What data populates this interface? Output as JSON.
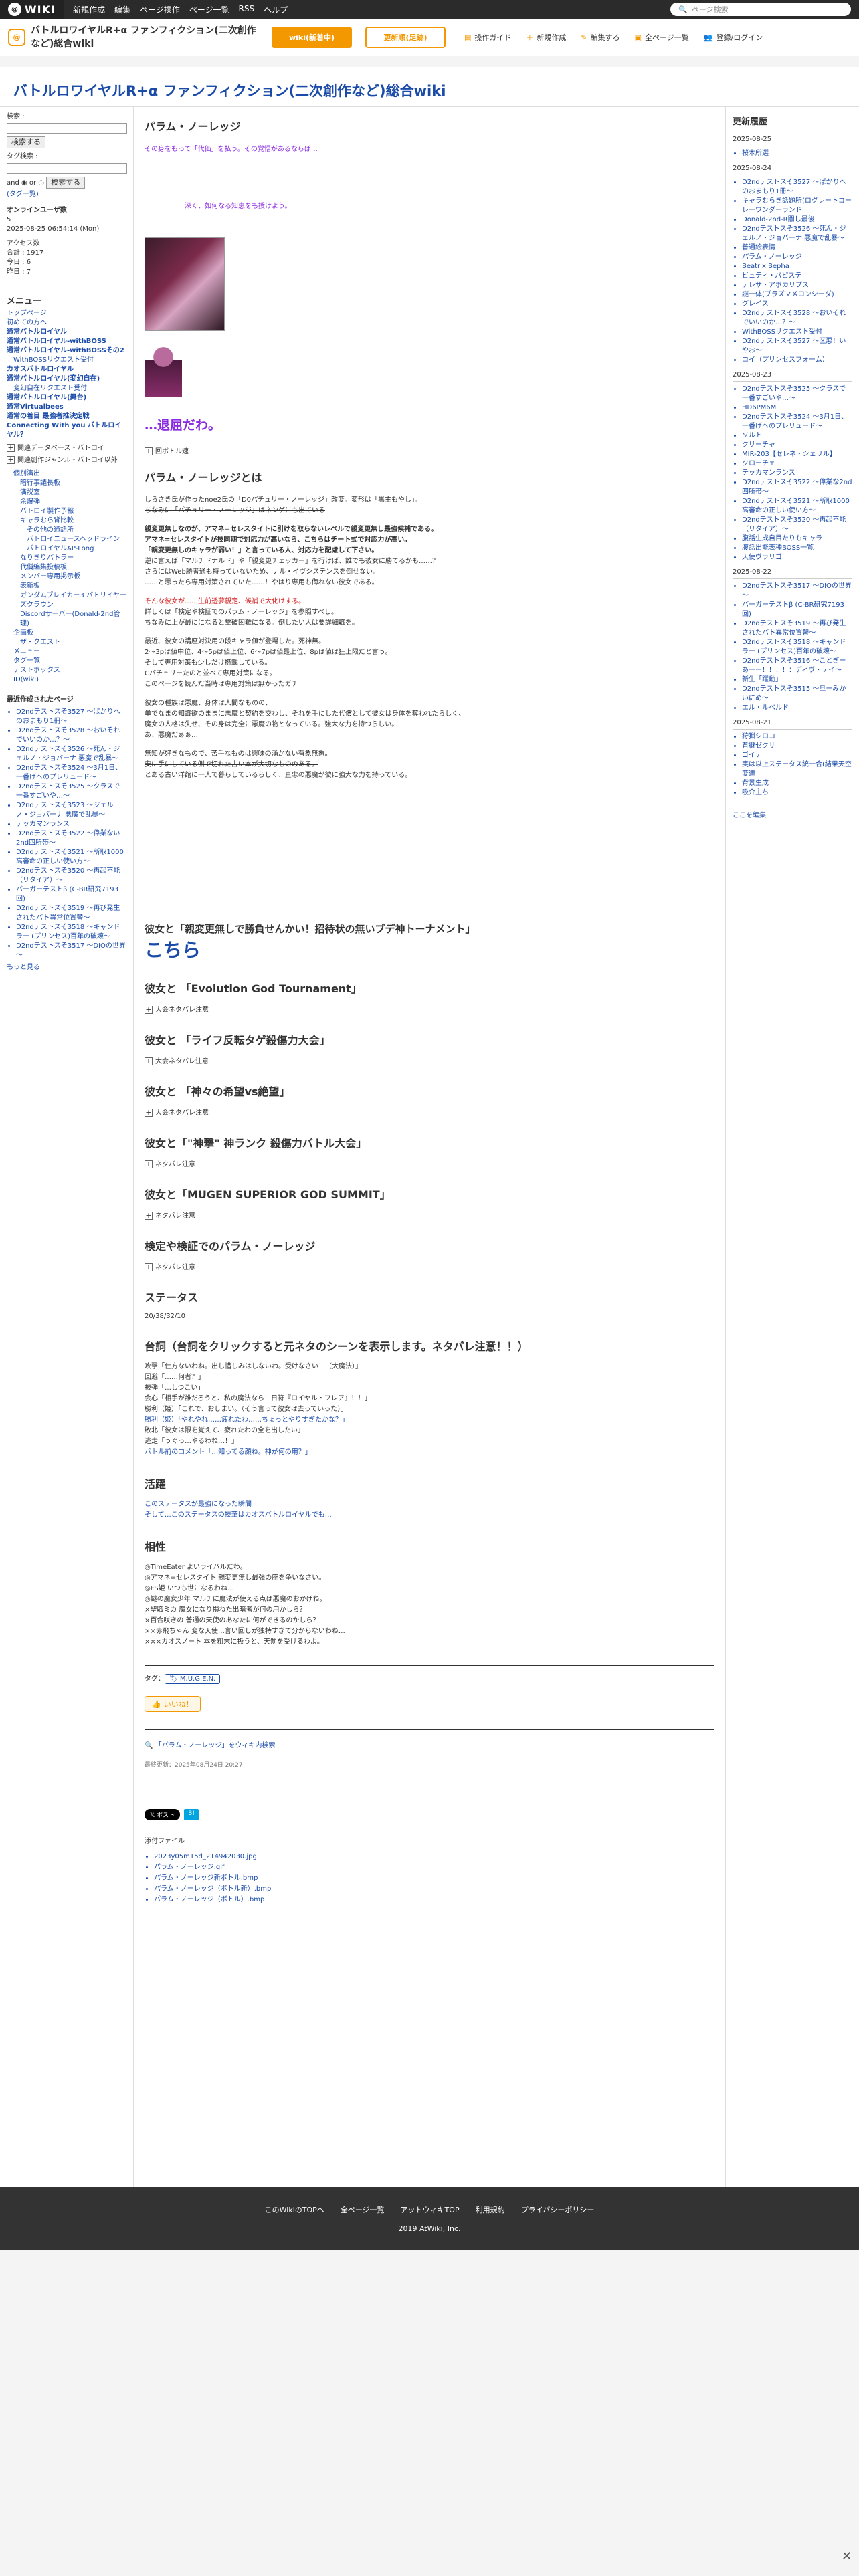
{
  "topbar": {
    "logo": "WIKI",
    "menu": [
      "新規作成",
      "編集",
      "ページ操作",
      "ページ一覧",
      "RSS",
      "ヘルプ"
    ],
    "search_placeholder": "ページ検索"
  },
  "header": {
    "title": "バトルロワイヤルR+α ファンフィクション(二次創作など)総合wiki",
    "btn_home": "wiki(新着中)",
    "btn_log": "更新順(足跡)",
    "nav": [
      "操作ガイド",
      "新規作成",
      "編集する",
      "全ページ一覧",
      "登録/ログイン"
    ]
  },
  "page_title": "バトルロワイヤルR+α ファンフィクション(二次創作など)総合wiki",
  "left": {
    "search_label": "検索 :",
    "search_btn": "検索する",
    "tag_label": "タグ検索 :",
    "and_or": "and ◉ or ○",
    "tag_btn": "検索する",
    "tag_link": "(タグ一覧)",
    "online_label": "オンラインユーザ数",
    "online_count": "5",
    "datetime": "2025-08-25 06:54:14 (Mon)",
    "access": "アクセス数",
    "total": "合計 : 1917",
    "today": "今日 : 6",
    "yesterday": "昨日 : 7",
    "menu_title": "メニュー",
    "menu": [
      {
        "t": "トップページ",
        "l": 0
      },
      {
        "t": "初めての方へ",
        "l": 0
      },
      {
        "t": "通常バトルロイヤル",
        "l": 0
      },
      {
        "t": "通常バトルロイヤル-withBOSS",
        "l": 0
      },
      {
        "t": "通常バトルロイヤル-withBOSSその2",
        "l": 0
      },
      {
        "t": "WithBOSSリクエスト受付",
        "l": 1
      },
      {
        "t": "カオスバトルロイヤル",
        "l": 0
      },
      {
        "t": "通常バトルロイヤル(変幻自在)",
        "l": 0
      },
      {
        "t": "変幻自在リクエスト受付",
        "l": 1
      },
      {
        "t": "通常バトルロイヤル(舞台)",
        "l": 0
      },
      {
        "t": "通常Virtualbees",
        "l": 0
      },
      {
        "t": "通常の着目 最強者推決定戦",
        "l": 0
      },
      {
        "t": "Connecting With you バトルロイヤル？",
        "l": 0
      }
    ],
    "folds": [
      "関連データベース・バトロイ",
      "関連創作ジャンル・バトロイ以外"
    ],
    "submenu": [
      {
        "t": "個別演出",
        "l": 0
      },
      {
        "t": "暗行事議長板",
        "l": 1
      },
      {
        "t": "演説室",
        "l": 1
      },
      {
        "t": "余爆弾",
        "l": 1
      },
      {
        "t": "バトロイ製作予報",
        "l": 1
      },
      {
        "t": "キャラむら背比較",
        "l": 1
      },
      {
        "t": "その他の通話所",
        "l": 2
      },
      {
        "t": "バトロイニュースヘッドライン",
        "l": 2
      },
      {
        "t": "バトロイヤルAP-Long",
        "l": 2
      },
      {
        "t": "なりきりバトラー",
        "l": 1
      },
      {
        "t": "代償編集投稿板",
        "l": 1
      },
      {
        "t": "メンバー専用掲示板",
        "l": 1
      },
      {
        "t": "表新板",
        "l": 1
      },
      {
        "t": "ガンダムブレイカー3 パトリイヤーズクラウン",
        "l": 1
      },
      {
        "t": "Discordサーバー(Donald-2nd管理)",
        "l": 1
      },
      {
        "t": "企画板",
        "l": 0
      },
      {
        "t": "ザ・クエスト",
        "l": 1
      },
      {
        "t": "メニュー",
        "l": 0
      },
      {
        "t": "タグ一覧",
        "l": 0
      },
      {
        "t": "テストボックス",
        "l": 0
      },
      {
        "t": "ID(wiki)",
        "l": 0
      }
    ],
    "recent_title": "最近作成されたページ",
    "recent": [
      "D2ndテストスそ3527 ～ぱかりへのおまもり1冊～",
      "D2ndテストスそ3528 ～おいそれでいいのか…？～",
      "D2ndテストスそ3526 ～死ん・ジェルノ・ジョバーナ 悪魔で乱暴～",
      "D2ndテストスそ3524 ～3月1日、一番げヘのプレリュード～",
      "D2ndテストスそ3525 ～クラスで一番すごいや…～",
      "D2ndテストスそ3523 ～ジェルノ・ジョバーナ 悪魔で乱暴～",
      "テッカマンランス",
      "D2ndテストスそ3522 ～偉業ない2nd四所帯～",
      "D2ndテストスそ3521 ～所取1000高審命の正しい使い方～",
      "D2ndテストスそ3520 ～再起不能（リタイア）～",
      "バーガーテストβ (C-BR研究7193回)",
      "D2ndテストスそ3519 ～再び発生されたバト異常位置替～",
      "D2ndテストスそ3518 ～キャンドラー (プリンセス)百年の破壊～",
      "D2ndテストスそ3517 ～DIOの世界～"
    ],
    "more": "もっと見る"
  },
  "main": {
    "char_name": "パラム・ノーレッジ",
    "quote": "その身をもって「代価」を払う。その覚悟があるならば…",
    "quote2": "深く、如何なる知恵をも授けよう。",
    "portrait_alt": "パラム・ノーレッジ(ボトル顔).bmp",
    "catchphrase": "…退屈だわ。",
    "fold1": "回ボトル速",
    "about_h": "パラム・ノーレッジとは",
    "about_p": [
      "しらさき氏が作ったnoe2氏の「D0パチュリー・ノーレッジ」改変。変形は「黒主もやし」。",
      "ちなみに「パチュリー・ノーレッジ」はネンゲにも出ている",
      "",
      "親変更無しなのが、アマネ=セレスタイトに引けを取らないレベルで親変更無し最強候補である。",
      "アマネ=セレスタイトが技同期で対応力が高いなら、こちらはチート式で対応力が高い。",
      "「親変更無しのキャラが弱い！」と言っている人、対応力を配慮して下さい。",
      "逆に言えば「マルチドナルド」や「親変更チェッカー」を行けば、誰でも彼女に勝てるかも……？",
      "さらにはWeb勝者通も持っていないため、ナル・イヴシステンスを倒せない。",
      "……と思ったら専用対策されていた……！やはり専用も侮れない彼女である。",
      "",
      "そんな彼女が……生前透夢親定、候補で大化けする。",
      "詳しくは「検定や検証でのパラム・ノーレッジ」を参照すべし。",
      "ちなみに上が最にになると撃破困難になる。倒したい人は要詳細職を。",
      "",
      "最近、彼女の講座対決用の段キャラ値が登場した。死神無。",
      "2〜3pは値中位、4〜5pは値上位、6〜7pは値最上位、8pは値は狂上限だと言う。",
      "そして専用対策も少しだけ搭載している。",
      "Cバチュリーたのと並べて専用対策になる。",
      "このページを読んだ当時は専用対策は無かったガチ",
      "",
      "彼女の種族は悪魔、身体は人間なものの、",
      "単でなまの知識欲のままに悪魔と契約を交わし、それを手にした代償として彼女は身体を奪われたらしく、",
      "魔女の人格は失せ、その身は完全に悪魔の物となっている。強大な力を持つらしい。",
      "あ、悪魔だぁぁ…",
      "",
      "無知が好きなもので、苦手なものは興味の湧かない有象無象。",
      "安に手にしている側で切れた古い本が大切なもののある。",
      "とある古い洋館に一人で暮らしているらしく、直忠の悪魔が彼に強大な力を持っている。"
    ],
    "tournament_h": "彼女と「親変更無しで勝負せんかい！招待状の無いブデ神トーナメント」",
    "tournament_link": "こちら",
    "sections": [
      {
        "h": "彼女と 「Evolution God Tournament」",
        "f": "大会ネタバレ注意"
      },
      {
        "h": "彼女と 「ライフ反転タゲ殺傷力大会」",
        "f": "大会ネタバレ注意"
      },
      {
        "h": "彼女と 「神々の希望vs絶望」",
        "f": "大会ネタバレ注意"
      },
      {
        "h": "彼女と「\"神撃\" 神ランク 殺傷力バトル大会」",
        "f": "ネタバレ注意"
      },
      {
        "h": "彼女と「MUGEN SUPERIOR GOD SUMMIT」",
        "f": "ネタバレ注意"
      },
      {
        "h": "検定や検証でのパラム・ノーレッジ",
        "f": "ネタバレ注意"
      }
    ],
    "status_h": "ステータス",
    "status_v": "20/38/32/10",
    "lines_h": "台詞（台詞をクリックすると元ネタのシーンを表示します。ネタバレ注意！！）",
    "lines": [
      "攻撃「仕方ないわね。出し惜しみはしないわ。受けなさい！（大魔法）」",
      "回避「……何者？」",
      "被弾「…しつこい」",
      "会心「相手が誰だろうと、私の魔法なら！日符『ロイヤル・フレア』！！」",
      "勝利（姫）「これで、おしまい。（そう言って彼女は去っていった）」",
      "勝利（姫）「やれやれ……疲れたわ……ちょっとやりすぎたかな？」",
      "敗北「彼女は限を覚えて、疲れたわの全を出したい」",
      "逃走「うぐっ…やるわね…！」",
      "バトル前のコメント「…知ってる顔ね。神が何の用？」"
    ],
    "active_h": "活躍",
    "active": [
      "このステータスが最強になった瞬間",
      "そして…このステータスの技華はカオスバトルロイヤルでも…"
    ],
    "compat_h": "相性",
    "compat": [
      "◎TimeEater よいライバルだわ。",
      "◎アマネ=セレスタイト 親変更無し最強の座を争いなさい。",
      "◎FS姫 いつも世になるわね…",
      "◎謎の魔女少年 マルチに魔法が使える点は悪魔のおかげね。",
      "×聖職ミカ 魔女になり損ねた出暗者が何の用かしら？",
      "×百合咲きの 普通の天使のあなたに何ができるのかしら？",
      "××赤飛ちゃん 変な天使…言い回しが独特すぎて分からないわね…",
      "×××カオスノート 本を粗末に扱うと、天罰を受けるわよ。"
    ],
    "tag_label": "タグ：",
    "tag": "M.U.G.E.N.",
    "iine": "いいね！",
    "search_link": "「パラム・ノーレッジ」をウィキ内検索",
    "updated": "最終更新：2025年08月24日 20:27",
    "share_x": "ポスト",
    "share_b": "B!",
    "attach_h": "添付ファイル",
    "attach": [
      "2023y05m15d_214942030.jpg",
      "パラム・ノーレッジ.gif",
      "パラム・ノーレッジ新ボトル.bmp",
      "パラム・ノーレッジ（ボトル新）.bmp",
      "パラム・ノーレッジ（ボトル）.bmp"
    ]
  },
  "right": {
    "title": "更新履歴",
    "groups": [
      {
        "d": "2025-08-25",
        "items": [
          "桜木所選"
        ]
      },
      {
        "d": "2025-08-24",
        "items": [
          "D2ndテストスそ3527 ～ぱかりへのおまもり1冊～",
          "キャラむらき話題所(ログレートコーレーワンダーランド",
          "Donald-2nd-R闇し最後",
          "D2ndテストスそ3526 ～死ん・ジェルノ・ジョバーナ 悪魔で乱暴～",
          "普通絵表情",
          "パラム・ノーレッジ",
          "Beatrix Bepha",
          "ビュティ・パピステ",
          "テレサ・アボカリプス",
          "謎一体(プラズマメロンシーダ)",
          "グレイス",
          "D2ndテストスそ3528 ～おいそれでいいのか…？～",
          "WithBOSSリクエスト受付",
          "D2ndテストスそ3527 ～区悪！いやお～",
          "コイ（プリンセスフォーム）"
        ]
      },
      {
        "d": "2025-08-23",
        "items": [
          "D2ndテストスそ3525 ～クラスで一番すごいや…～",
          "HD6PM6M",
          "D2ndテストスそ3524 ～3月1日、一番げヘのプレリュード～",
          "ソルト",
          "クリーチャ",
          "MIR-203【セレネ・シェリル】",
          "クローチェ",
          "テッカマンランス",
          "D2ndテストスそ3522 ～偉業な2nd四所帯～",
          "D2ndテストスそ3521 ～所取1000高審命の正しい使い方～",
          "D2ndテストスそ3520 ～再起不能（リタイア）～",
          "腹話生成自目たりもキャラ",
          "腹話出能表種BOSS一覧",
          "天使ヴラリゴ"
        ]
      },
      {
        "d": "2025-08-22",
        "items": [
          "D2ndテストスそ3517 ～DIOの世界～",
          "バーガーテストβ (C-BR研究7193回)",
          "D2ndテストスそ3519 ～再び発生されたバト異常位置替～",
          "D2ndテストスそ3518 ～キャンドラー (プリンセス)百年の破壊～",
          "D2ndテストスそ3516 ～ことぎーあーー！！！！：ディヴ・テイ～",
          "新生「躍動」",
          "D2ndテストスそ3515 ～旦ーみかいにめ～",
          "エル・ルベルド"
        ]
      },
      {
        "d": "2025-08-21",
        "items": [
          "狩猟シロコ",
          "背継ゼクサ",
          "ゴイテ",
          "実は以上ステータス統一合(結果天空変達",
          "背景生成",
          "吸介主ち"
        ]
      }
    ],
    "edit": "ここを編集"
  },
  "footer": {
    "links": [
      "このWikiのTOPへ",
      "全ページ一覧",
      "アットウィキTOP",
      "利用規約",
      "プライバシーポリシー"
    ],
    "copy": "2019 AtWiki, Inc."
  }
}
